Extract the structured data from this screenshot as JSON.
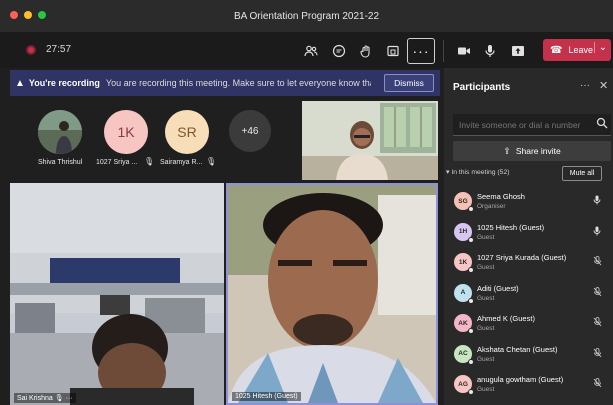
{
  "window": {
    "title": "BA Orientation Program 2021-22",
    "traffic_colors": [
      "#ff5f57",
      "#febc2e",
      "#28c840"
    ]
  },
  "toolbar": {
    "timer": "27:57",
    "more_label": "···",
    "leave_label": "Leave",
    "leave_color": "#c4314b"
  },
  "banner": {
    "strong": "You're recording",
    "message": "You are recording this meeting. Make sure to let everyone know that they a...",
    "dismiss": "Dismiss",
    "bg_color": "#2f3465"
  },
  "avatars": [
    {
      "initials": "",
      "name": "Shiva Thrishul",
      "color": "#6d7f6a"
    },
    {
      "initials": "1K",
      "name": "1027 Sriya ...",
      "color": "#f7c6c2"
    },
    {
      "initials": "SR",
      "name": "Sairamya R...",
      "color": "#f7ddb8"
    }
  ],
  "more_count": "+46",
  "tiles": {
    "left_label": "Sai Krishna",
    "right_label": "1025 Hitesh (Guest)"
  },
  "panel": {
    "title": "Participants",
    "invite_placeholder": "Invite someone or dial a number",
    "share_invite": "Share invite",
    "in_meeting": "In this meeting (52)",
    "mute_all": "Mute all"
  },
  "participants": [
    {
      "initials": "SG",
      "name": "Seema Ghosh",
      "role": "Organiser",
      "color": "#f4c1b4",
      "mic": "on"
    },
    {
      "initials": "1H",
      "name": "1025 Hitesh (Guest)",
      "role": "Guest",
      "color": "#d6c7f0",
      "mic": "on"
    },
    {
      "initials": "1K",
      "name": "1027 Sriya Kurada (Guest)",
      "role": "Guest",
      "color": "#f7c6c2",
      "mic": "off"
    },
    {
      "initials": "A",
      "name": "Aditi (Guest)",
      "role": "Guest",
      "color": "#bfe3ee",
      "mic": "off"
    },
    {
      "initials": "AK",
      "name": "Ahmed K (Guest)",
      "role": "Guest",
      "color": "#f3b6c6",
      "mic": "off"
    },
    {
      "initials": "AC",
      "name": "Akshata Chetan (Guest)",
      "role": "Guest",
      "color": "#c8e6c0",
      "mic": "off"
    },
    {
      "initials": "AG",
      "name": "anugula gowtham (Guest)",
      "role": "Guest",
      "color": "#f7c6c2",
      "mic": "off"
    }
  ]
}
